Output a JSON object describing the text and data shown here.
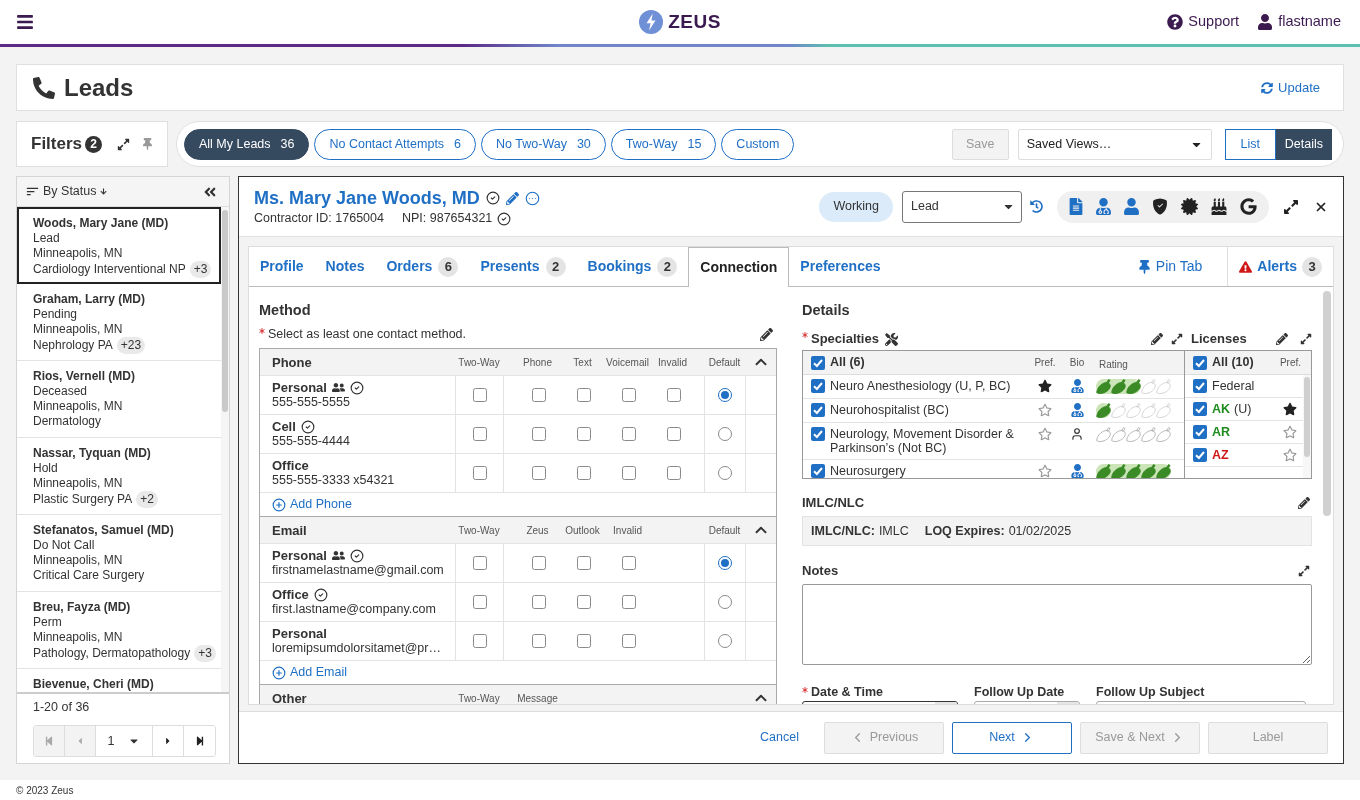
{
  "header": {
    "logo_text": "ZEUS",
    "links": [
      {
        "kind": "help",
        "label": "Support"
      },
      {
        "kind": "user",
        "label": "flastname"
      }
    ]
  },
  "page": {
    "title": "Leads",
    "action": "Update"
  },
  "filters": {
    "label": "Filters",
    "count": "2"
  },
  "views": [
    {
      "label": "All My Leads",
      "count": "36",
      "selected": true
    },
    {
      "label": "No Contact Attempts",
      "count": "6",
      "selected": false
    },
    {
      "label": "No Two-Way",
      "count": "30",
      "selected": false
    },
    {
      "label": "Two-Way",
      "count": "15",
      "selected": false
    },
    {
      "label": "Custom",
      "selected": false
    }
  ],
  "save_button": {
    "label": "Save",
    "disabled": true
  },
  "saved_views": {
    "value": "Saved Views…"
  },
  "display_modes": [
    {
      "label": "List",
      "selected": false
    },
    {
      "label": "Details",
      "selected": true
    }
  ],
  "lead_list": {
    "sort_label": "By Status",
    "items": [
      {
        "name": "Woods, Mary Jane (MD)",
        "status": "Lead",
        "location": "Minneapolis, MN",
        "specialty": "Cardiology Interventional NP",
        "extra": "+3",
        "selected": true
      },
      {
        "name": "Graham, Larry (MD)",
        "status": "Pending",
        "location": "Minneapolis, MN",
        "specialty": "Nephrology PA",
        "extra": "+23",
        "selected": false
      },
      {
        "name": "Rios, Vernell (MD)",
        "status": "Deceased",
        "location": "Minneapolis, MN",
        "specialty": "Dermatology",
        "selected": false
      },
      {
        "name": "Nassar, Tyquan (MD)",
        "status": "Hold",
        "location": "Minneapolis, MN",
        "specialty": "Plastic Surgery PA",
        "extra": "+2",
        "selected": false
      },
      {
        "name": "Stefanatos, Samuel (MD)",
        "status": "Do Not Call",
        "location": "Minneapolis, MN",
        "specialty": "Critical Care Surgery",
        "selected": false
      },
      {
        "name": "Breu, Fayza (MD)",
        "status": "Perm",
        "location": "Minneapolis, MN",
        "specialty": "Pathology, Dermatopathology",
        "extra": "+3",
        "selected": false
      },
      {
        "name": "Bievenue, Cheri (MD)",
        "selected": false
      }
    ],
    "range": "1-20 of 36",
    "pager": {
      "page": "1",
      "buttons": [
        {
          "kind": "first",
          "disabled": true
        },
        {
          "kind": "previous",
          "disabled": true
        },
        {
          "kind": "next",
          "disabled": false
        },
        {
          "kind": "last",
          "disabled": false
        }
      ]
    }
  },
  "lead": {
    "name": "Ms. Mary Jane Woods, MD",
    "name_verified": true,
    "contractor_id": "Contractor ID: 1765004",
    "npi": "NPI: 987654321",
    "npi_verified": true,
    "status": "Working",
    "stage": {
      "value": "Lead"
    },
    "quick_links": [
      {
        "kind": "document",
        "active": true
      },
      {
        "kind": "doctor",
        "active": true
      },
      {
        "kind": "person",
        "active": true
      },
      {
        "kind": "shield",
        "active": false
      },
      {
        "kind": "seal",
        "active": false
      },
      {
        "kind": "cake",
        "active": false
      },
      {
        "kind": "google",
        "active": false
      }
    ],
    "tabs": [
      {
        "label": "Profile",
        "selected": false
      },
      {
        "label": "Notes",
        "selected": false
      },
      {
        "label": "Orders",
        "count": "6",
        "selected": false
      },
      {
        "label": "Presents",
        "count": "2",
        "selected": false
      },
      {
        "label": "Bookings",
        "count": "2",
        "selected": false
      },
      {
        "label": "Connection",
        "selected": true
      },
      {
        "label": "Preferences",
        "selected": false
      }
    ],
    "pin_tab": {
      "label": "Pin Tab"
    },
    "alerts": {
      "label": "Alerts",
      "count": "3"
    },
    "method": {
      "title": "Method",
      "note": "Select as least one contact method.",
      "required": true,
      "groups": [
        {
          "title": "Phone",
          "columns": [
            "Two-Way",
            "Phone",
            "Text",
            "Voicemail",
            "Invalid"
          ],
          "default_label": "Default",
          "expanded": true,
          "rows": [
            {
              "label": "Personal",
              "shared": true,
              "verified": true,
              "value": "555-555-5555",
              "checks": [
                {
                  "checked": false
                },
                {
                  "checked": false
                },
                {
                  "checked": false
                },
                {
                  "checked": false
                },
                {
                  "checked": false
                }
              ],
              "default": true
            },
            {
              "label": "Cell",
              "shared": false,
              "verified": true,
              "value": "555-555-4444",
              "checks": [
                {
                  "checked": false
                },
                {
                  "checked": false
                },
                {
                  "checked": false
                },
                {
                  "checked": false
                },
                {
                  "checked": false
                }
              ],
              "default": false
            },
            {
              "label": "Office",
              "shared": false,
              "verified": false,
              "value": "555-555-3333 x54321",
              "checks": [
                {
                  "checked": false
                },
                {
                  "checked": false
                },
                {
                  "checked": false
                },
                {
                  "checked": false
                },
                {
                  "checked": false
                }
              ],
              "default": false
            }
          ],
          "add_label": "Add Phone"
        },
        {
          "title": "Email",
          "columns": [
            "Two-Way",
            "Zeus",
            "Outlook",
            "Invalid"
          ],
          "default_label": "Default",
          "expanded": true,
          "rows": [
            {
              "label": "Personal",
              "shared": true,
              "verified": true,
              "value": "firstnamelastname@gmail.com",
              "checks": [
                {
                  "checked": false
                },
                {
                  "checked": false
                },
                {
                  "checked": false
                },
                {
                  "checked": false
                }
              ],
              "default": true
            },
            {
              "label": "Office",
              "shared": false,
              "verified": true,
              "value": "first.lastname@company.com",
              "checks": [
                {
                  "checked": false
                },
                {
                  "checked": false
                },
                {
                  "checked": false
                },
                {
                  "checked": false
                }
              ],
              "default": false
            },
            {
              "label": "Personal",
              "shared": false,
              "verified": false,
              "value": "loremipsumdolorsitamet@pr…",
              "checks": [
                {
                  "checked": false
                },
                {
                  "checked": false
                },
                {
                  "checked": false
                },
                {
                  "checked": false
                }
              ],
              "default": false
            }
          ],
          "add_label": "Add Email"
        },
        {
          "title": "Other",
          "columns": [
            "Two-Way",
            "Message"
          ],
          "expanded": true
        }
      ]
    },
    "details": {
      "title": "Details",
      "specialties": {
        "title": "Specialties",
        "required": true,
        "all_label": "All (6)",
        "all_checked": true,
        "columns": [
          "Pref.",
          "Bio",
          "Rating"
        ],
        "rows": [
          {
            "name": "Neuro Anesthesiology (U, P, BC)",
            "checked": true,
            "preferred": true,
            "bio": true,
            "rated": true,
            "stars": 3
          },
          {
            "name": "Neurohospitalist (BC)",
            "checked": true,
            "preferred": false,
            "bio": true,
            "rated": true,
            "stars": 1
          },
          {
            "name": "Neurology, Movement Disorder & Parkinson’s (Not BC)",
            "checked": true,
            "preferred": false,
            "bio": false,
            "rated": false,
            "stars": 0
          },
          {
            "name": "Neurosurgery",
            "checked": true,
            "preferred": false,
            "bio": true,
            "rated": true,
            "stars": 5
          }
        ]
      },
      "licenses": {
        "title": "Licenses",
        "all_label": "All (10)",
        "all_checked": true,
        "column": "Pref.",
        "rows": [
          {
            "kind": "federal",
            "code": "Federal",
            "checked": true
          },
          {
            "kind": "state",
            "code": "AK",
            "qualifier": "(U)",
            "checked": true,
            "preferred": true,
            "color": "#1e8c1e"
          },
          {
            "kind": "state",
            "code": "AR",
            "checked": true,
            "preferred": false,
            "color": "#1e8c1e"
          },
          {
            "kind": "state",
            "code": "AZ",
            "checked": true,
            "preferred": false,
            "color": "#d01818"
          }
        ]
      },
      "imlc": {
        "title": "IMLC/NLC",
        "fields": [
          {
            "label": "IMLC/NLC:",
            "value": "IMLC"
          },
          {
            "label": "LOQ Expires:",
            "value": "01/02/2025"
          }
        ]
      },
      "notes": {
        "title": "Notes"
      },
      "follow_up": [
        {
          "kind": "datetime",
          "label": "Date & Time",
          "required": true
        },
        {
          "kind": "date",
          "label": "Follow Up Date",
          "required": false
        },
        {
          "kind": "text",
          "label": "Follow Up Subject",
          "required": false
        }
      ]
    },
    "footer_buttons": [
      {
        "kind": "link",
        "label": "Cancel",
        "disabled": false
      },
      {
        "kind": "back",
        "label": "Previous",
        "disabled": true
      },
      {
        "kind": "forward",
        "label": "Next",
        "disabled": false
      },
      {
        "kind": "forward",
        "label": "Save & Next",
        "disabled": true
      },
      {
        "kind": "plain",
        "label": "Label",
        "disabled": true
      }
    ]
  },
  "copyright": "© 2023 Zeus"
}
